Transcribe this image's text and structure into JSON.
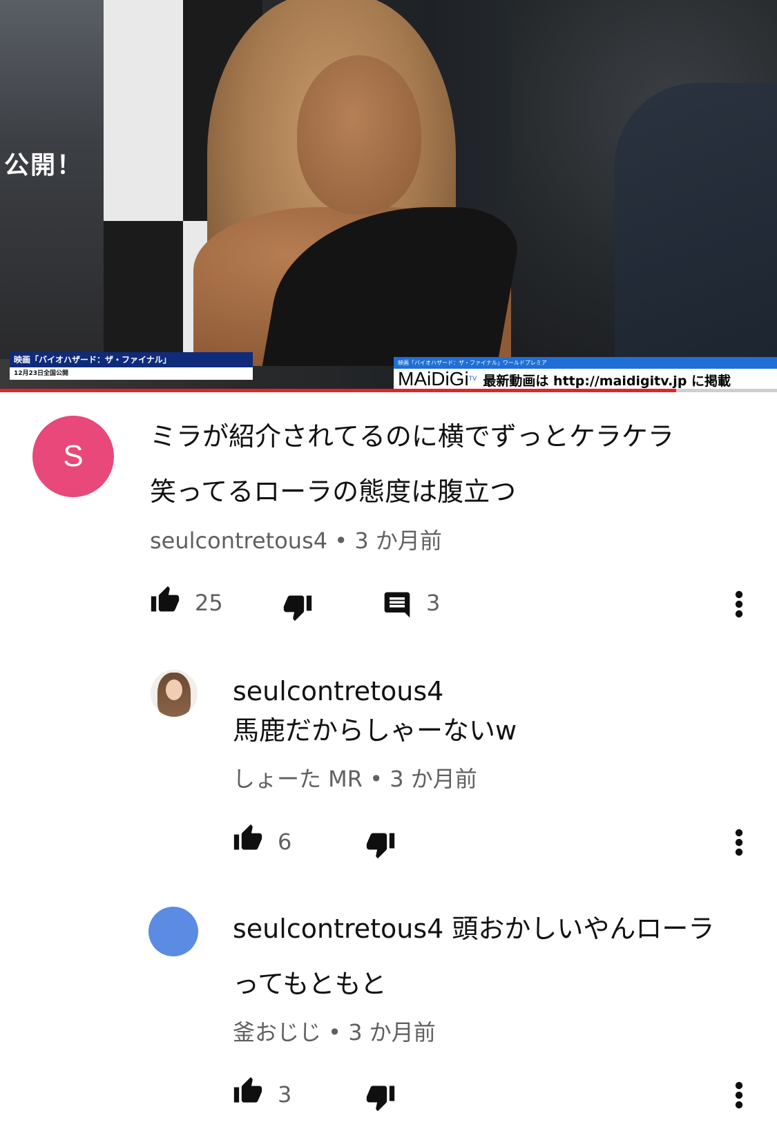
{
  "video": {
    "poster_text": "公開！",
    "caption_left_title": "映画「バイオハザード：ザ・ファイナル」",
    "caption_left_sub": "12月23日全国公開",
    "caption_right_title": "映画「バイオハザード：ザ・ファイナル」ワールドプレミア",
    "brand": "MAiDiGi",
    "brand_tv": "TV",
    "caption_right_msg": "最新動画は http://maidigitv.jp に掲載",
    "progress": 0.87,
    "colors": {
      "progress": "#e22626",
      "caption_left": "#0f2b7a",
      "caption_right": "#1f6fd6"
    }
  },
  "comments": {
    "main": {
      "avatar_letter": "S",
      "avatar_color": "#e8487a",
      "text_line1": "ミラが紹介されてるのに横でずっとケラケラ",
      "text_line2": "笑ってるローラの態度は腹立つ",
      "meta": "seulcontretous4 • 3 か月前",
      "likes": "25",
      "replies": "3"
    },
    "reply1": {
      "mention": "seulcontretous4",
      "text": "馬鹿だからしゃーないw",
      "meta": "しょーた MR • 3 か月前",
      "likes": "6"
    },
    "reply2": {
      "text_line1": "seulcontretous4 頭おかしいやんローラ",
      "text_line2": "ってもともと",
      "meta": "釜おじじ • 3 か月前",
      "likes": "3",
      "avatar_color": "#5b8be3"
    }
  },
  "icons": [
    "thumb-up-icon",
    "thumb-down-icon",
    "reply-icon",
    "more-vert-icon"
  ]
}
